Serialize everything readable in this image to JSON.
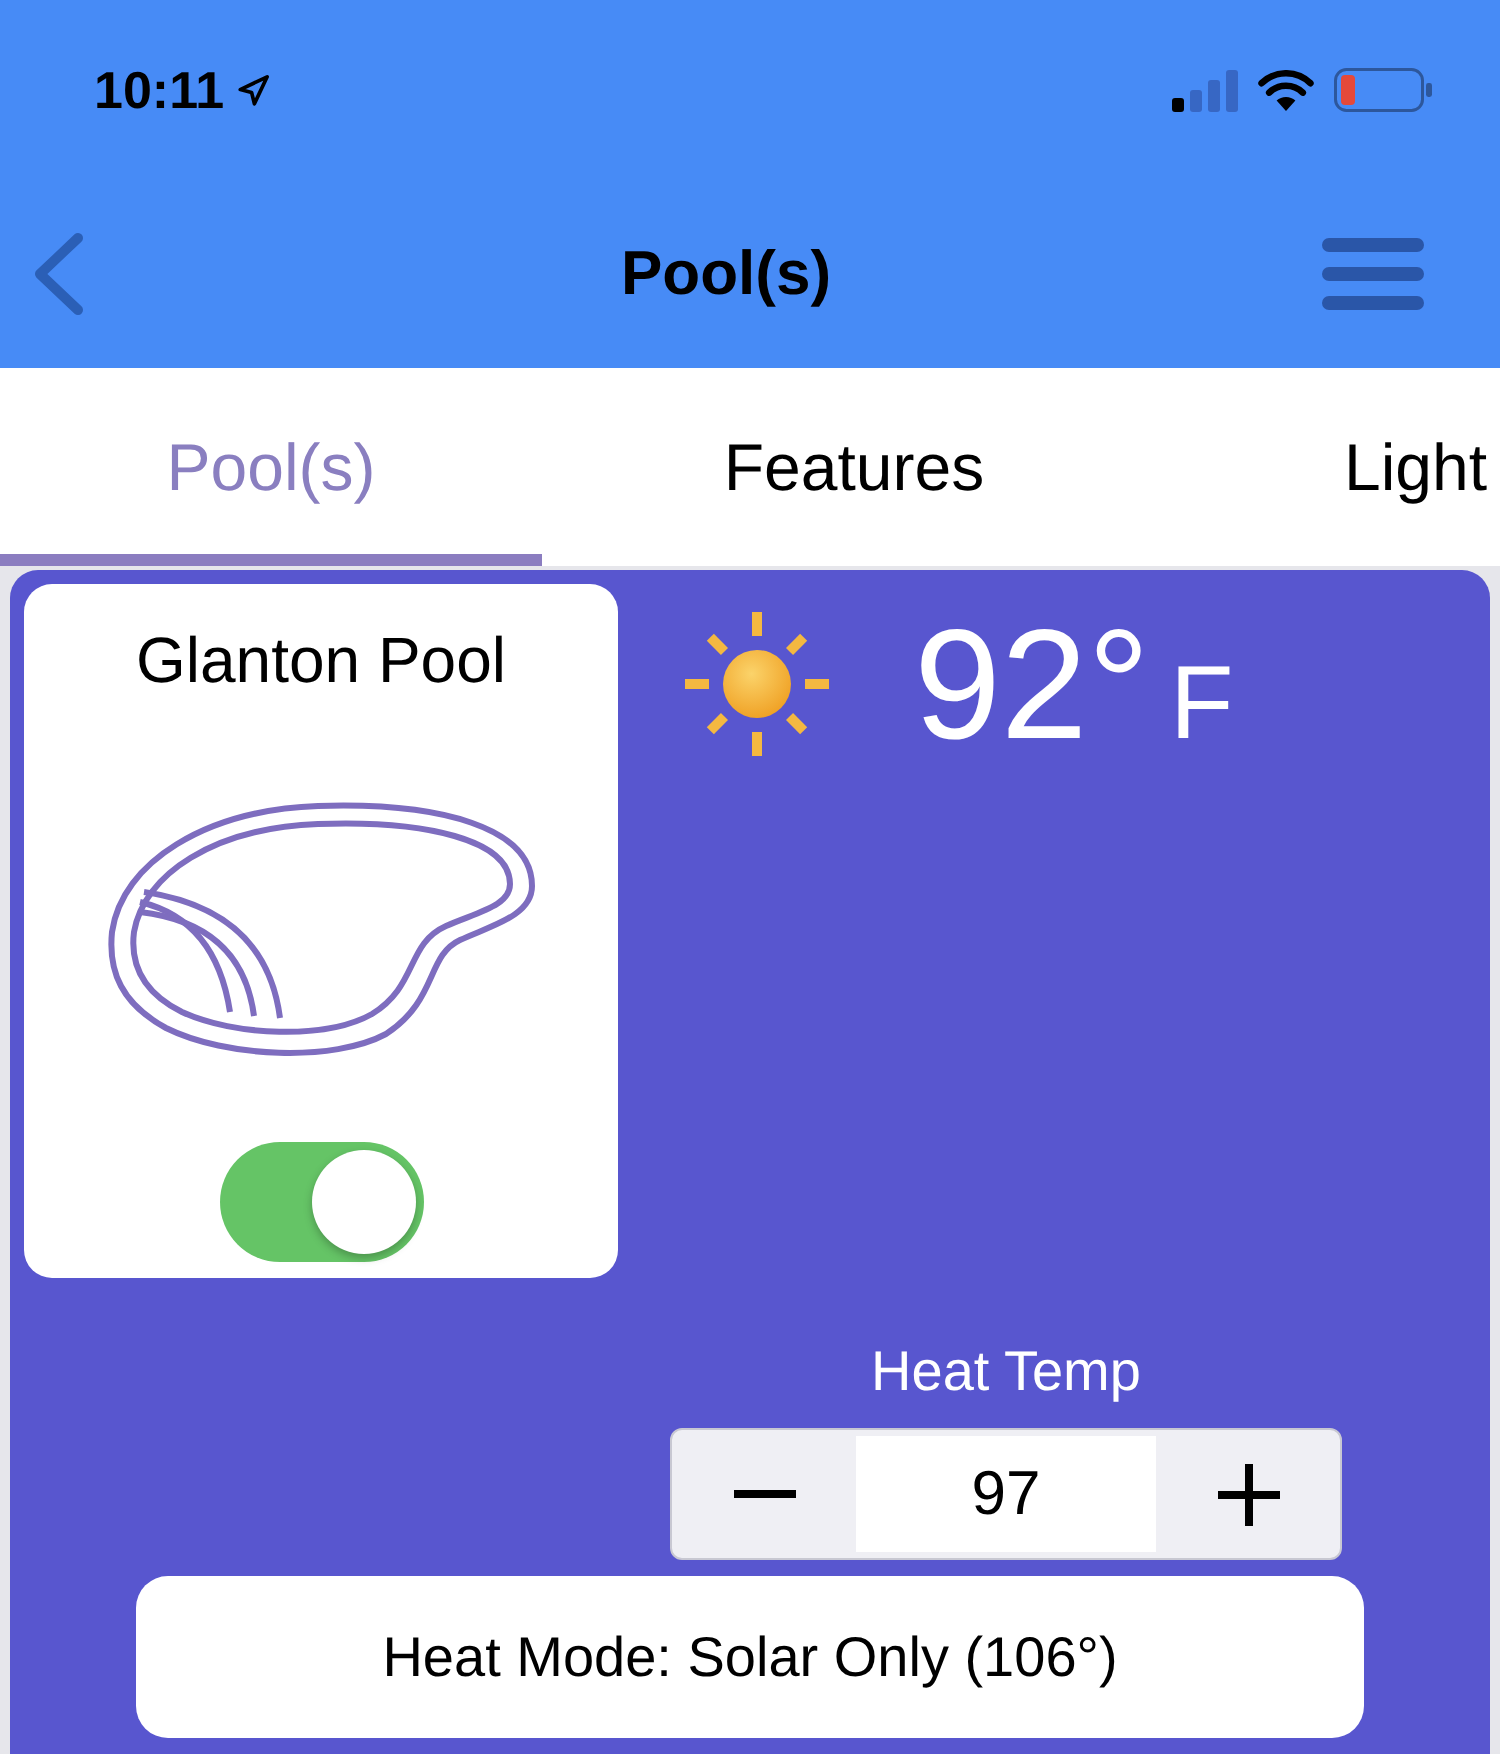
{
  "status_bar": {
    "time": "10:11"
  },
  "nav_bar": {
    "title": "Pool(s)"
  },
  "tabs": [
    {
      "label": "Pool(s)",
      "selected": true
    },
    {
      "label": "Features",
      "selected": false
    },
    {
      "label": "Light",
      "selected": false
    }
  ],
  "pool": {
    "name": "Glanton Pool",
    "on": true
  },
  "weather": {
    "temperature": "92°",
    "unit": "F"
  },
  "heat_temp": {
    "label": "Heat Temp",
    "value": "97"
  },
  "heat_mode": {
    "label": "Heat Mode: Solar Only (106°)"
  }
}
